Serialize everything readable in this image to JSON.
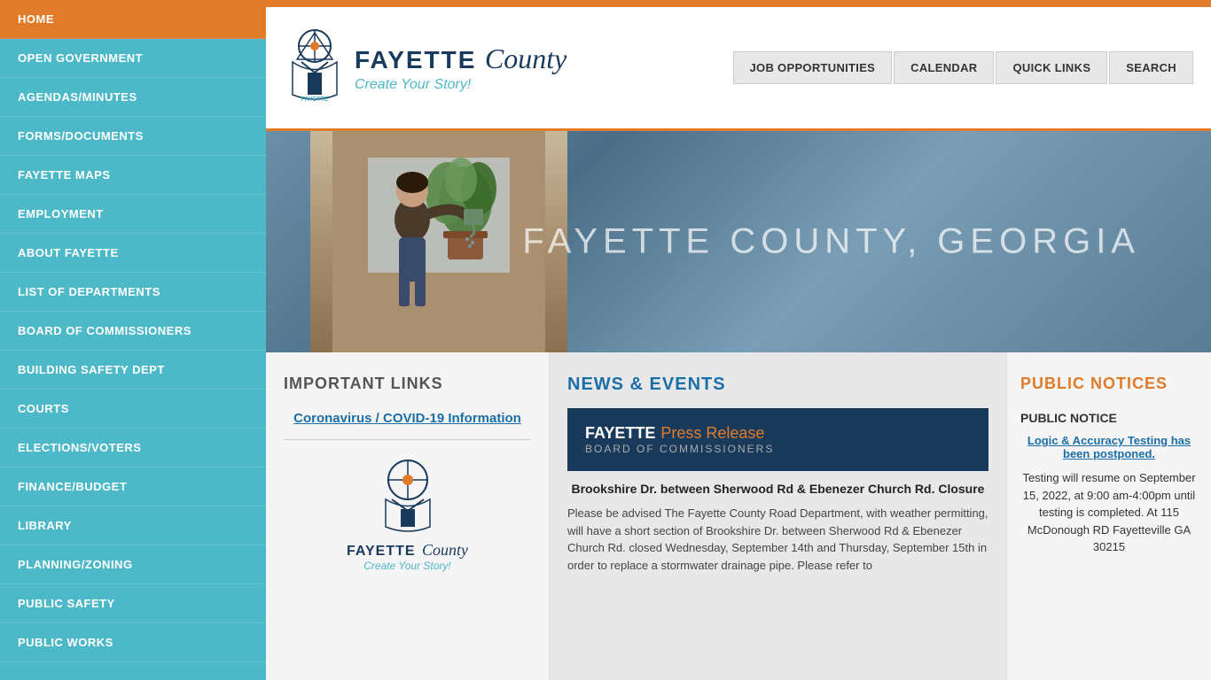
{
  "sidebar": {
    "items": [
      {
        "id": "home",
        "label": "HOME",
        "active": true
      },
      {
        "id": "open-government",
        "label": "OPEN GOVERNMENT",
        "active": false
      },
      {
        "id": "agendas-minutes",
        "label": "AGENDAS/MINUTES",
        "active": false
      },
      {
        "id": "forms-documents",
        "label": "FORMS/DOCUMENTS",
        "active": false
      },
      {
        "id": "fayette-maps",
        "label": "FAYETTE MAPS",
        "active": false
      },
      {
        "id": "employment",
        "label": "EMPLOYMENT",
        "active": false
      },
      {
        "id": "about-fayette",
        "label": "ABOUT FAYETTE",
        "active": false
      },
      {
        "id": "list-of-departments",
        "label": "LIST OF DEPARTMENTS",
        "active": false
      },
      {
        "id": "board-of-commissioners",
        "label": "BOARD OF COMMISSIONERS",
        "active": false
      },
      {
        "id": "building-safety-dept",
        "label": "BUILDING SAFETY DEPT",
        "active": false
      },
      {
        "id": "courts",
        "label": "COURTS",
        "active": false
      },
      {
        "id": "elections-voters",
        "label": "ELECTIONS/VOTERS",
        "active": false
      },
      {
        "id": "finance-budget",
        "label": "FINANCE/BUDGET",
        "active": false
      },
      {
        "id": "library",
        "label": "LIBRARY",
        "active": false
      },
      {
        "id": "planning-zoning",
        "label": "PLANNING/ZONING",
        "active": false
      },
      {
        "id": "public-safety",
        "label": "PUBLIC SAFETY",
        "active": false
      },
      {
        "id": "public-works",
        "label": "PUBLIC WORKS",
        "active": false
      }
    ]
  },
  "header": {
    "logo_fayette": "FAYETTE",
    "logo_county": "County",
    "logo_tagline": "Create Your Story!",
    "nav_buttons": [
      {
        "id": "job-opportunities",
        "label": "JOB OPPORTUNITIES"
      },
      {
        "id": "calendar",
        "label": "CALENDAR"
      },
      {
        "id": "quick-links",
        "label": "QUICK LINKS"
      },
      {
        "id": "search",
        "label": "SEARCH"
      }
    ]
  },
  "hero": {
    "title": "FAYETTE COUNTY, GEORGIA"
  },
  "important_links": {
    "section_title": "IMPORTANT LINKS",
    "links": [
      {
        "id": "covid-link",
        "label": "Coronavirus / COVID-19 Information"
      }
    ],
    "logo_fayette": "FAYETTE",
    "logo_county": "County",
    "logo_tagline": "Create Your Story!"
  },
  "news_events": {
    "section_title": "NEWS & EVENTS",
    "banner_fayette": "FAYETTE",
    "banner_press": "Press Release",
    "banner_subtitle": "BOARD OF COMMISSIONERS",
    "headline": "Brookshire Dr. between Sherwood Rd & Ebenezer Church Rd. Closure",
    "body": "Please be advised The Fayette County Road Department, with weather permitting, will have a short section of Brookshire Dr. between Sherwood Rd & Ebenezer Church Rd. closed Wednesday, September 14th and Thursday, September 15th in order to replace a stormwater drainage pipe. Please refer to"
  },
  "public_notices": {
    "section_title": "PUBLIC NOTICES",
    "notice_label": "PUBLIC NOTICE",
    "link1": "Logic & Accuracy Testing has been postponed.",
    "notice_text": "Testing will resume on September 15, 2022, at 9:00 am-4:00pm until testing is completed.  At 115 McDonough RD Fayetteville GA 30215"
  }
}
